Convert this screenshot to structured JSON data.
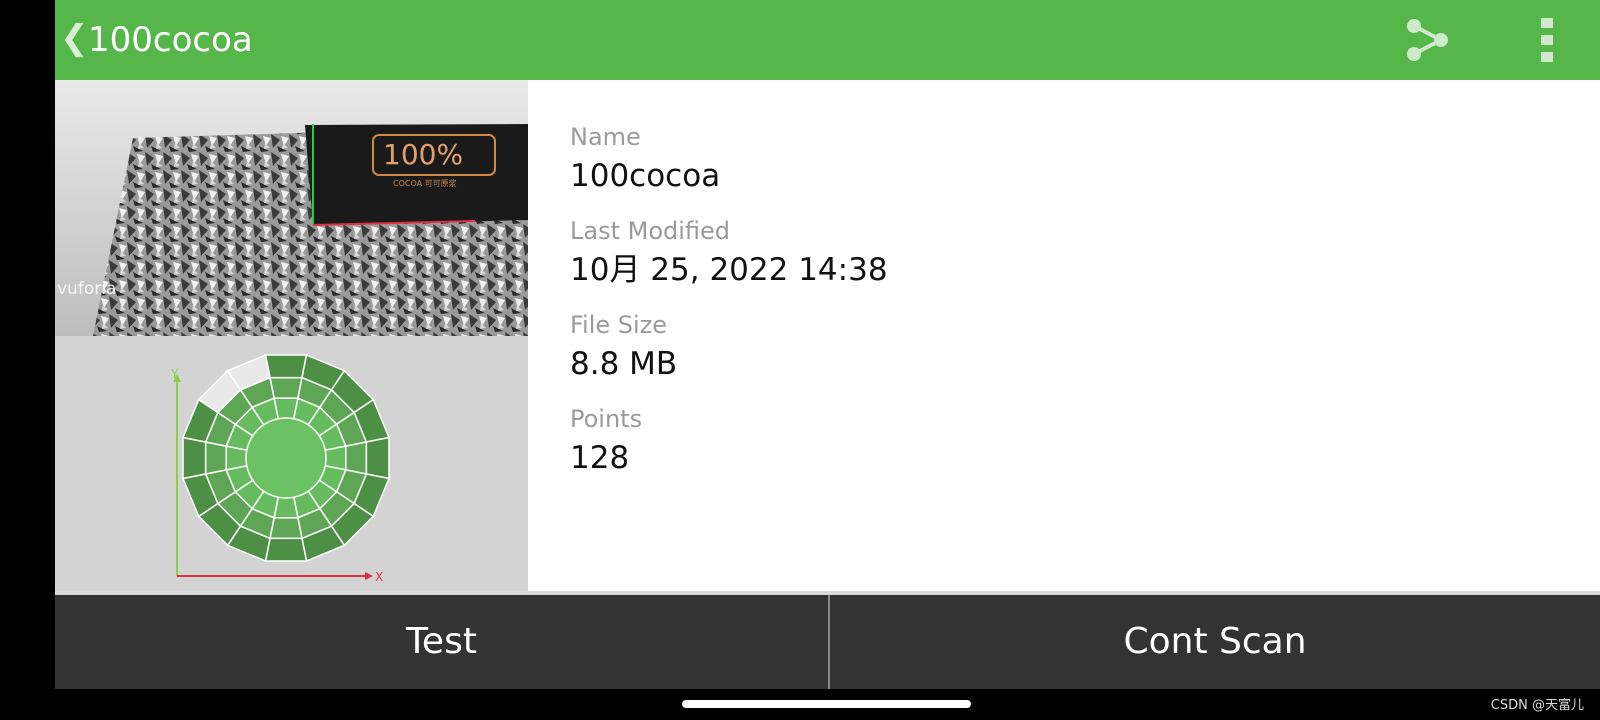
{
  "topbar": {
    "back_icon": "chevron-left-icon",
    "title": "100cocoa",
    "share_icon": "share-icon",
    "more_icon": "more-vertical-icon",
    "color": "#55b74a"
  },
  "preview": {
    "watermark": "vuforia",
    "box_label": "100%",
    "box_sub": "COCOA 可可原浆",
    "axis_x": "X",
    "axis_y": "Y"
  },
  "details": {
    "name_label": "Name",
    "name_value": "100cocoa",
    "modified_label": "Last Modified",
    "modified_value": "10月 25, 2022 14:38",
    "size_label": "File Size",
    "size_value": "8.8 MB",
    "points_label": "Points",
    "points_value": "128"
  },
  "actions": {
    "test_label": "Test",
    "cont_scan_label": "Cont Scan"
  },
  "footer": {
    "credit": "CSDN @天富儿"
  }
}
